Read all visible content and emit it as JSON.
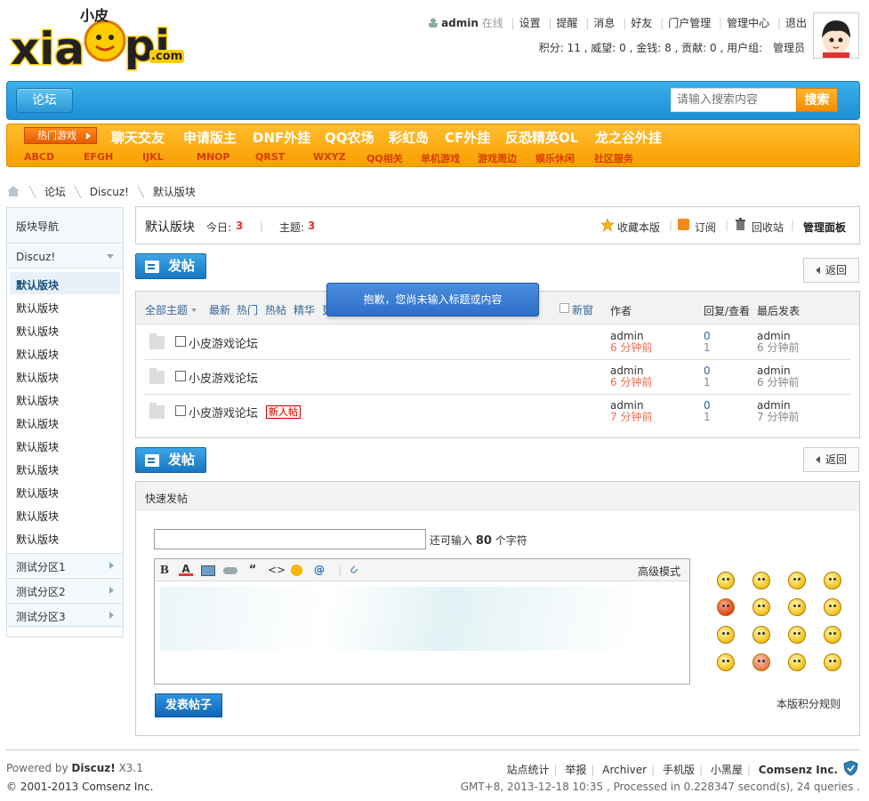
{
  "brand": {
    "logo_text": "xiaopi",
    "logo_sub": "小皮",
    "logo_domain": ".com",
    "accent": "#1c8fd3",
    "orange": "#f9a000"
  },
  "user": {
    "name": "admin",
    "status": "在线",
    "links": [
      "设置",
      "提醒",
      "消息",
      "好友",
      "门户管理",
      "管理中心",
      "退出"
    ],
    "credits": "积分: 11 , 威望: 0 , 金钱: 8 , 贡献: 0 , 用户组:",
    "group": "管理员"
  },
  "nav": {
    "forum": "论坛",
    "search_placeholder": "请输入搜索内容",
    "search_btn": "搜索"
  },
  "hot": {
    "label": "热门游戏",
    "big": [
      "聊天交友",
      "申请版主",
      "DNF外挂",
      "QQ农场",
      "彩虹岛",
      "CF外挂",
      "反恐精英OL",
      "龙之谷外挂"
    ],
    "small": [
      "ABCD",
      "EFGH",
      "IJKL",
      "MNOP",
      "QRST",
      "WXYZ",
      "QQ相关",
      "单机游戏",
      "游戏周边",
      "娱乐休闲",
      "社区服务"
    ]
  },
  "crumb": [
    "论坛",
    "Discuz!",
    "默认版块"
  ],
  "sidebar": {
    "title": "版块导航",
    "group": "Discuz!",
    "items": [
      "默认版块",
      "默认版块",
      "默认版块",
      "默认版块",
      "默认版块",
      "默认版块",
      "默认版块",
      "默认版块",
      "默认版块",
      "默认版块",
      "默认版块",
      "默认版块"
    ],
    "zones": [
      "测试分区1",
      "测试分区2",
      "测试分区3"
    ]
  },
  "board": {
    "name": "默认版块",
    "today_label": "今日:",
    "today": "3",
    "topics_label": "主题:",
    "topics": "3",
    "fav": "收藏本版",
    "rss": "订阅",
    "trash": "回收站",
    "admin": "管理面板"
  },
  "actions": {
    "post": "发帖",
    "back": "返回"
  },
  "tooltip": "抱歉，您尚未输入标题或内容",
  "list": {
    "filters": [
      "全部主题",
      "最新",
      "热门",
      "热帖",
      "精华",
      "更"
    ],
    "newwin": "新窗",
    "col_author": "作者",
    "col_reply": "回复/查看",
    "col_last": "最后发表",
    "threads": [
      {
        "title": "小皮游戏论坛",
        "author": "admin",
        "time": "6 分钟前",
        "replies": "0",
        "views": "1",
        "last_author": "admin",
        "last_time": "6 分钟前",
        "badge": ""
      },
      {
        "title": "小皮游戏论坛",
        "author": "admin",
        "time": "6 分钟前",
        "replies": "0",
        "views": "1",
        "last_author": "admin",
        "last_time": "6 分钟前",
        "badge": ""
      },
      {
        "title": "小皮游戏论坛",
        "author": "admin",
        "time": "7 分钟前",
        "replies": "0",
        "views": "1",
        "last_author": "admin",
        "last_time": "7 分钟前",
        "badge": "新人帖"
      }
    ]
  },
  "quickpost": {
    "title": "快速发帖",
    "remain_prefix": "还可输入",
    "remain_count": "80",
    "remain_suffix": "个字符",
    "advanced": "高级模式",
    "submit": "发表帖子",
    "rules": "本版积分规则"
  },
  "footer": {
    "powered_prefix": "Powered by",
    "powered_name": "Discuz!",
    "powered_ver": "X3.1",
    "copyright": "© 2001-2013",
    "company": "Comsenz Inc.",
    "links": [
      "站点统计",
      "举报",
      "Archiver",
      "手机版",
      "小黑屋"
    ],
    "company2": "Comsenz Inc.",
    "stats": "GMT+8, 2013-12-18 10:35 , Processed in 0.228347 second(s), 24 queries ."
  }
}
